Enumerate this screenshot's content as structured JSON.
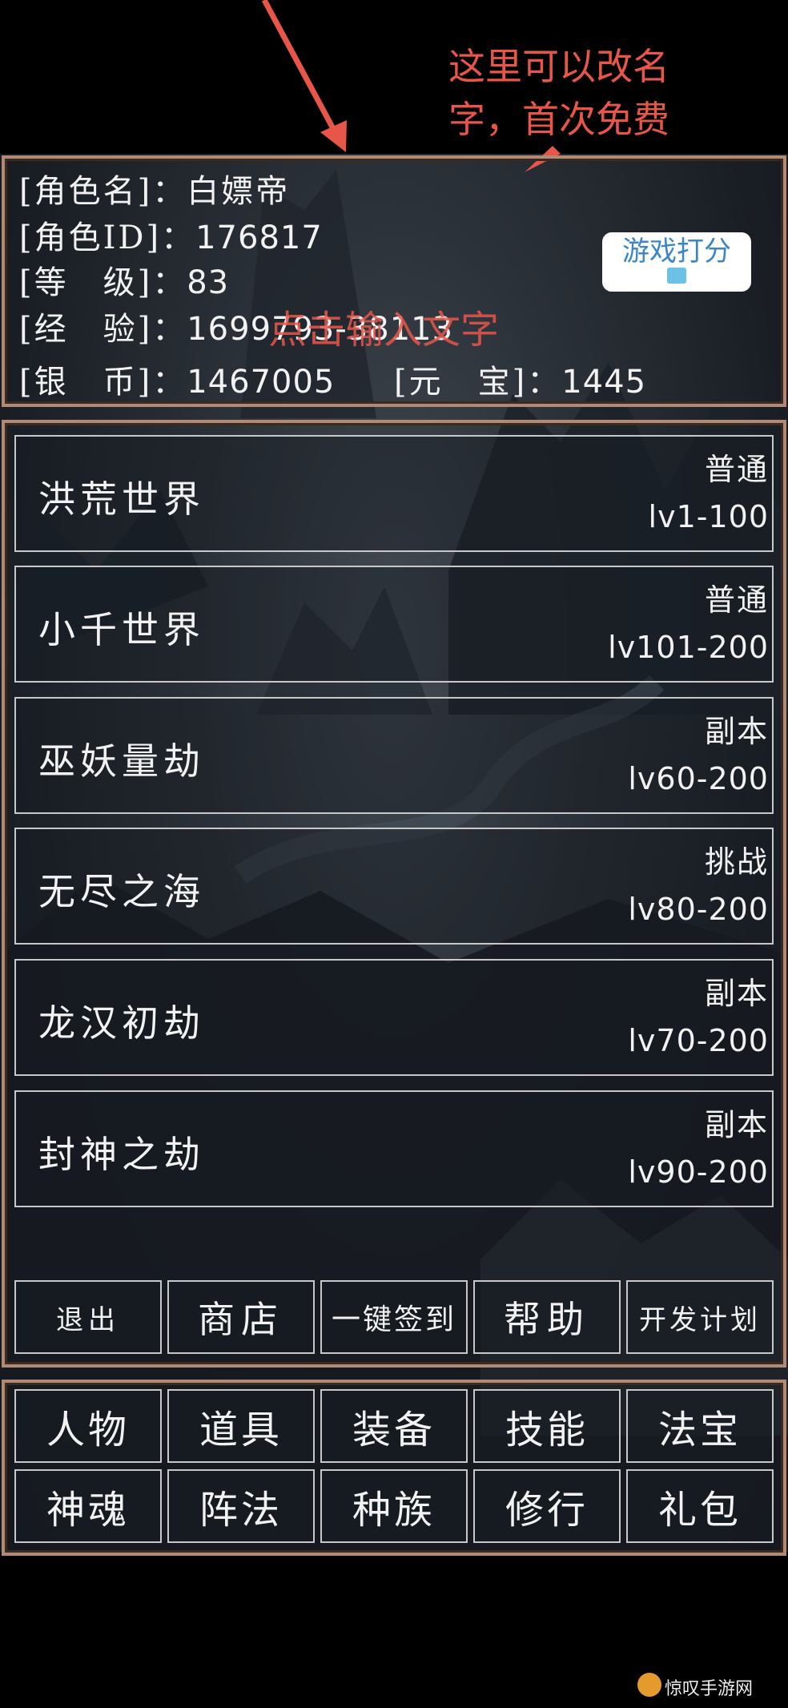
{
  "annotation": {
    "note": "这里可以改名字，首次免费",
    "overlay": "点击输入文字"
  },
  "profile": {
    "name_label": "[角色名]：",
    "name": "白嫖帝",
    "id_label": "[角色ID]：",
    "id": "176817",
    "level_label": "[等　级]：",
    "level": "83",
    "exp_label": "[经　验]：",
    "exp": "1699793-38113",
    "silver_label": "[银　币]：",
    "silver": "1467005",
    "yuanbao_label": "[元　宝]：",
    "yuanbao": "1445",
    "rate_button": "游戏打分"
  },
  "worlds": [
    {
      "name": "洪荒世界",
      "type": "普通",
      "level": "lv1-100"
    },
    {
      "name": "小千世界",
      "type": "普通",
      "level": "lv101-200"
    },
    {
      "name": "巫妖量劫",
      "type": "副本",
      "level": "lv60-200"
    },
    {
      "name": "无尽之海",
      "type": "挑战",
      "level": "lv80-200"
    },
    {
      "name": "龙汉初劫",
      "type": "副本",
      "level": "lv70-200"
    },
    {
      "name": "封神之劫",
      "type": "副本",
      "level": "lv90-200"
    }
  ],
  "actions": [
    "退出",
    "商店",
    "一键签到",
    "帮助",
    "开发计划"
  ],
  "menu": [
    "人物",
    "道具",
    "装备",
    "技能",
    "法宝",
    "神魂",
    "阵法",
    "种族",
    "修行",
    "礼包"
  ],
  "watermark": "惊叹手游网"
}
